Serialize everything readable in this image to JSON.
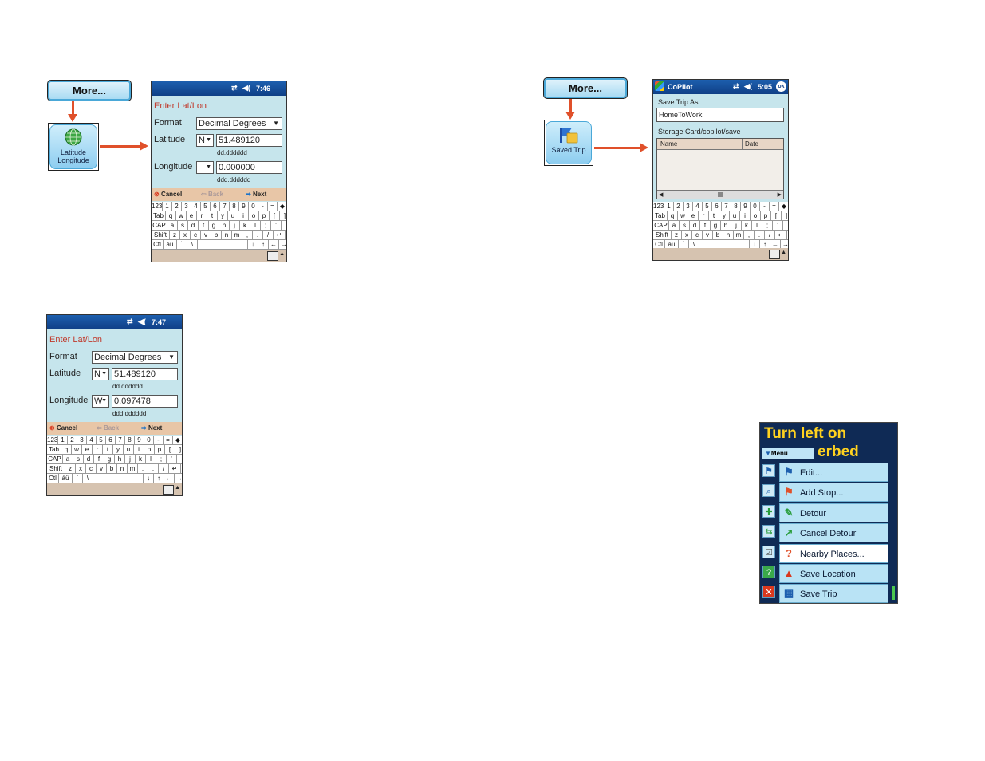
{
  "panel1": {
    "more_label": "More...",
    "icon_label_line1": "Latitude",
    "icon_label_line2": "Longitude",
    "icon_name": "globe-icon",
    "screen": {
      "time": "7:46",
      "form_title": "Enter Lat/Lon",
      "format_label": "Format",
      "format_value": "Decimal Degrees",
      "latitude_label": "Latitude",
      "lat_dir": "N",
      "lat_value": "51.489120",
      "lat_hint": "dd.dddddd",
      "longitude_label": "Longitude",
      "lon_dir": "",
      "lon_value": "0.000000",
      "lon_hint": "ddd.dddddd",
      "cancel": "Cancel",
      "back": "Back",
      "next": "Next"
    }
  },
  "panel2": {
    "screen": {
      "time": "7:47",
      "form_title": "Enter Lat/Lon",
      "format_label": "Format",
      "format_value": "Decimal Degrees",
      "latitude_label": "Latitude",
      "lat_dir": "N",
      "lat_value": "51.489120",
      "lat_hint": "dd.dddddd",
      "longitude_label": "Longitude",
      "lon_dir": "W",
      "lon_value": "0.097478",
      "lon_hint": "ddd.dddddd",
      "cancel": "Cancel",
      "back": "Back",
      "next": "Next"
    }
  },
  "panel3": {
    "more_label": "More...",
    "icon_label": "Saved Trip",
    "icon_name": "saved-trip-icon",
    "screen": {
      "app_title": "CoPilot",
      "time": "5:05",
      "ok": "ok",
      "save_as_label": "Save Trip As:",
      "save_as_value": "HomeToWork",
      "path": "Storage Card/copilot/save",
      "col_name": "Name",
      "col_date": "Date"
    }
  },
  "keyboard": {
    "row1": [
      "123",
      "1",
      "2",
      "3",
      "4",
      "5",
      "6",
      "7",
      "8",
      "9",
      "0",
      "-",
      "=",
      "◆"
    ],
    "row2": [
      "Tab",
      "q",
      "w",
      "e",
      "r",
      "t",
      "y",
      "u",
      "i",
      "o",
      "p",
      "[",
      "]"
    ],
    "row3": [
      "CAP",
      "a",
      "s",
      "d",
      "f",
      "g",
      "h",
      "j",
      "k",
      "l",
      ";",
      "'"
    ],
    "row4": [
      "Shift",
      "z",
      "x",
      "c",
      "v",
      "b",
      "n",
      "m",
      ",",
      ".",
      "/",
      "↵"
    ],
    "row5": [
      "Ctl",
      "áü",
      "`",
      "\\",
      " ",
      "↓",
      "↑",
      "←",
      "→"
    ]
  },
  "menu_panel": {
    "banner_line1": "Turn left on",
    "banner_line2": "erbed",
    "menu_tab": "Menu",
    "items": [
      {
        "label": "Edit...",
        "icon": "flag-icon"
      },
      {
        "label": "Add Stop...",
        "icon": "add-stop-icon"
      },
      {
        "label": "Detour",
        "icon": "detour-icon"
      },
      {
        "label": "Cancel Detour",
        "icon": "cancel-detour-icon"
      },
      {
        "label": "Nearby Places...",
        "icon": "nearby-places-icon"
      },
      {
        "label": "Save Location",
        "icon": "save-location-icon"
      },
      {
        "label": "Save Trip",
        "icon": "save-trip-icon"
      }
    ],
    "selected_index": 4,
    "colors": {
      "banner_bg": "#0f2a55",
      "banner_text": "#ffd21f",
      "item_bg": "#b9e3f5"
    }
  }
}
